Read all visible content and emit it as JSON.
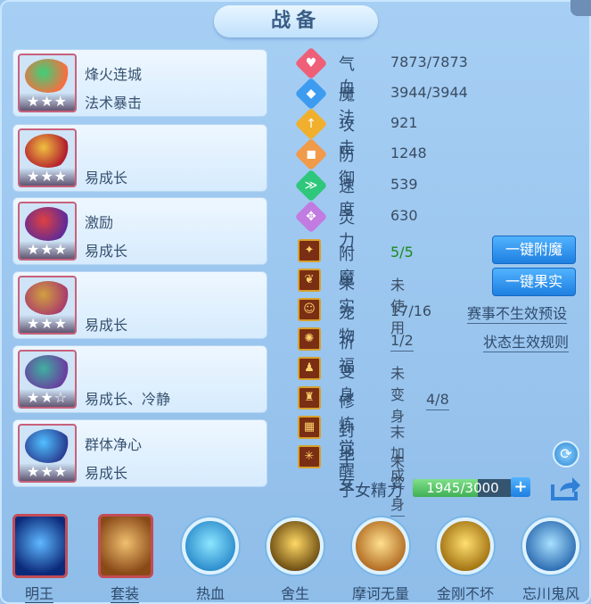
{
  "title": "战备",
  "equipment": [
    {
      "name": "烽火连城",
      "desc": "法术暴击",
      "stars": "★★★",
      "colors": [
        "#ff6a3d",
        "#3bd17a"
      ]
    },
    {
      "name": "",
      "desc": "易成长",
      "stars": "★★★",
      "colors": [
        "#b0182c",
        "#f0c040"
      ]
    },
    {
      "name": "激励",
      "desc": "易成长",
      "stars": "★★★",
      "colors": [
        "#5b2a9a",
        "#e04040"
      ]
    },
    {
      "name": "",
      "desc": "易成长",
      "stars": "★★★",
      "colors": [
        "#a93a6c",
        "#d0a040"
      ]
    },
    {
      "name": "",
      "desc": "易成长、冷静",
      "stars": "★★☆",
      "colors": [
        "#6a3aa0",
        "#40b0a0"
      ]
    },
    {
      "name": "群体净心",
      "desc": "易成长",
      "stars": "★★★",
      "colors": [
        "#283a90",
        "#50c0ff"
      ]
    }
  ],
  "stats": [
    {
      "label": "气血",
      "value": "7873/7873",
      "color": "#ef5f78",
      "icon": "heart-icon",
      "glyph": "♥"
    },
    {
      "label": "魔法",
      "value": "3944/3944",
      "color": "#3d9cf0",
      "icon": "mana-icon",
      "glyph": "◆"
    },
    {
      "label": "攻击",
      "value": "921",
      "color": "#f0b02e",
      "icon": "attack-icon",
      "glyph": "↑"
    },
    {
      "label": "防御",
      "value": "1248",
      "color": "#f19a4a",
      "icon": "shield-icon",
      "glyph": "◼"
    },
    {
      "label": "速度",
      "value": "539",
      "color": "#2ec77c",
      "icon": "speed-icon",
      "glyph": "≫"
    },
    {
      "label": "灵力",
      "value": "630",
      "color": "#c27be0",
      "icon": "spirit-icon",
      "glyph": "✥"
    }
  ],
  "rows": [
    {
      "label": "附魔",
      "value": "5/5",
      "icon": "enchant-icon",
      "glyph": "✦"
    },
    {
      "label": "果实",
      "value": "未使用",
      "icon": "fruit-icon",
      "glyph": "❦"
    },
    {
      "label": "宠物",
      "value": "17/16",
      "icon": "pet-icon",
      "glyph": "☺"
    },
    {
      "label": "祈福",
      "value": "1/2",
      "icon": "bless-icon",
      "glyph": "✺"
    },
    {
      "label": "变身",
      "value": "未变身",
      "icon": "transform-icon",
      "glyph": "♟"
    },
    {
      "label": "修炼觉醒",
      "value": "4/8",
      "icon": "cultivate-icon",
      "glyph": "♜"
    },
    {
      "label": "封地",
      "value": "未加成",
      "icon": "fief-icon",
      "glyph": "▦"
    },
    {
      "label": "子女",
      "value": "未变身",
      "icon": "child-icon",
      "glyph": "✳"
    }
  ],
  "buttons": {
    "enchant": "一键附魔",
    "fruit": "一键果实"
  },
  "links": {
    "preset": "赛事不生效预设",
    "rules": "状态生效规则"
  },
  "energy": {
    "label": "子女精力",
    "text": "1945/3000",
    "fraction": 0.648
  },
  "skills": [
    {
      "name": "明王",
      "type": "square",
      "colors": [
        "#5fb8ff",
        "#0c2a7a"
      ]
    },
    {
      "name": "套装",
      "type": "square",
      "colors": [
        "#f0c070",
        "#8a4a18"
      ]
    },
    {
      "name": "热血",
      "type": "circle",
      "colors": [
        "#8ce6ff",
        "#2a8acb"
      ]
    },
    {
      "name": "舍生",
      "type": "circle",
      "colors": [
        "#ffd866",
        "#6a4a10"
      ]
    },
    {
      "name": "摩诃无量",
      "type": "circle",
      "colors": [
        "#ffe090",
        "#b06a20"
      ]
    },
    {
      "name": "金刚不坏",
      "type": "circle",
      "colors": [
        "#ffe070",
        "#a07010"
      ]
    },
    {
      "name": "忘川鬼风",
      "type": "circle",
      "colors": [
        "#a8e0ff",
        "#2a6ab0"
      ]
    }
  ]
}
